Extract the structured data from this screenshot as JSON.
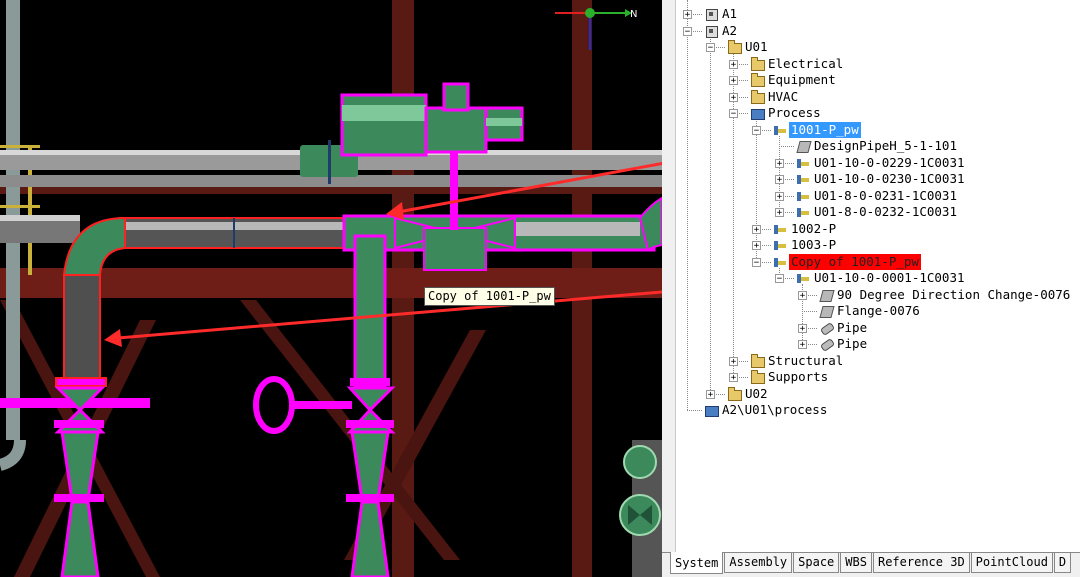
{
  "compass": {
    "north_label": "N"
  },
  "viewport": {
    "tooltip": "Copy of 1001-P_pw"
  },
  "tree": {
    "items": [
      {
        "label": "A1",
        "level": 1,
        "icon": "component-icon",
        "expander": "+"
      },
      {
        "label": "A2",
        "level": 1,
        "icon": "component-icon",
        "expander": "-"
      },
      {
        "label": "U01",
        "level": 2,
        "icon": "unit-folder-icon",
        "expander": "-"
      },
      {
        "label": "Electrical",
        "level": 3,
        "icon": "electrical-folder-icon",
        "expander": "+"
      },
      {
        "label": "Equipment",
        "level": 3,
        "icon": "equipment-folder-icon",
        "expander": "+"
      },
      {
        "label": "HVAC",
        "level": 3,
        "icon": "hvac-folder-icon",
        "expander": "+"
      },
      {
        "label": "Process",
        "level": 3,
        "icon": "process-folder-icon",
        "expander": "-"
      },
      {
        "label": "1001-P_pw",
        "level": 4,
        "icon": "pipeline-icon",
        "expander": "-",
        "highlight": "blue"
      },
      {
        "label": "DesignPipeH_5-1-101",
        "level": 5,
        "icon": "design-pipe-icon",
        "expander": ""
      },
      {
        "label": "U01-10-0-0229-1C0031",
        "level": 5,
        "icon": "pipe-run-icon",
        "expander": "+"
      },
      {
        "label": "U01-10-0-0230-1C0031",
        "level": 5,
        "icon": "pipe-run-icon",
        "expander": "+"
      },
      {
        "label": "U01-8-0-0231-1C0031",
        "level": 5,
        "icon": "pipe-run-icon",
        "expander": "+"
      },
      {
        "label": "U01-8-0-0232-1C0031",
        "level": 5,
        "icon": "pipe-run-icon",
        "expander": "+"
      },
      {
        "label": "1002-P",
        "level": 4,
        "icon": "pipeline-icon",
        "expander": "+"
      },
      {
        "label": "1003-P",
        "level": 4,
        "icon": "pipeline-icon",
        "expander": "+"
      },
      {
        "label": "Copy of 1001-P_pw",
        "level": 4,
        "icon": "pipeline-icon",
        "expander": "-",
        "highlight": "red"
      },
      {
        "label": "U01-10-0-0001-1C0031",
        "level": 5,
        "icon": "pipe-run-icon",
        "expander": "-"
      },
      {
        "label": "90 Degree Direction Change-0076",
        "level": 6,
        "icon": "elbow-part-icon",
        "expander": "+"
      },
      {
        "label": "Flange-0076",
        "level": 6,
        "icon": "flange-part-icon",
        "expander": ""
      },
      {
        "label": "Pipe",
        "level": 6,
        "icon": "pipe-part-icon",
        "expander": "+"
      },
      {
        "label": "Pipe",
        "level": 6,
        "icon": "pipe-part-icon",
        "expander": "+"
      },
      {
        "label": "Structural",
        "level": 3,
        "icon": "structural-folder-icon",
        "expander": "+"
      },
      {
        "label": "Supports",
        "level": 3,
        "icon": "supports-folder-icon",
        "expander": "+"
      },
      {
        "label": "U02",
        "level": 2,
        "icon": "unit-folder-icon",
        "expander": "+"
      },
      {
        "label": "A2\\U01\\process",
        "level": 1,
        "icon": "process-folder-icon",
        "expander": ""
      }
    ]
  },
  "tabs": [
    {
      "label": "System",
      "active": true
    },
    {
      "label": "Assembly",
      "active": false
    },
    {
      "label": "Space",
      "active": false
    },
    {
      "label": "WBS",
      "active": false
    },
    {
      "label": "Reference 3D",
      "active": false
    },
    {
      "label": "PointCloud",
      "active": false
    },
    {
      "label": "D",
      "active": false
    }
  ],
  "colors": {
    "highlight_magenta": "#ff00ff",
    "selection_red": "#ff0000",
    "selection_blue": "#3399ff",
    "pipe_green": "#3c8a5c",
    "steel_brown": "#5a1a14"
  }
}
